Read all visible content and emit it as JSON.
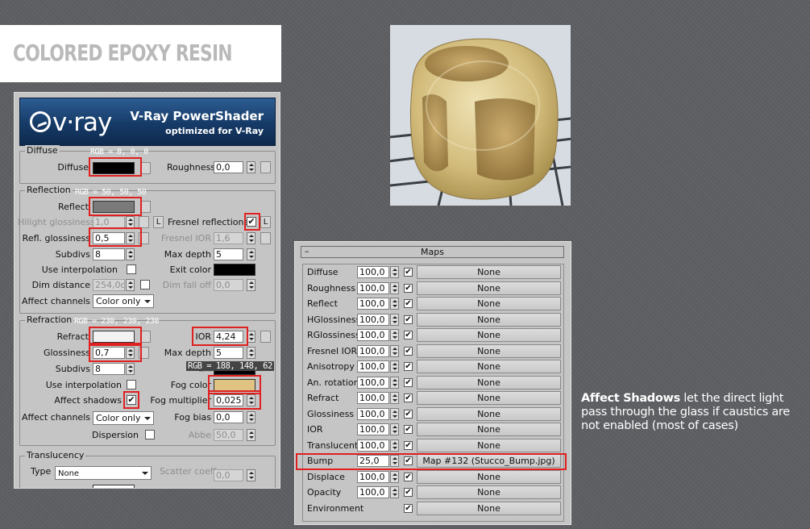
{
  "title": "COLORED EPOXY RESIN",
  "vray": {
    "logo": "v·ray",
    "header_title": "V-Ray PowerShader",
    "header_subtitle": "optimized for V-Ray"
  },
  "diffuse": {
    "group": "Diffuse",
    "rgb_note": "RGB = 0, 0, 0",
    "diffuse_label": "Diffuse",
    "diffuse_color": "#000000",
    "roughness_label": "Roughness",
    "roughness_value": "0,0"
  },
  "reflection": {
    "group": "Reflection",
    "rgb_note": "RGB = 50, 50, 50",
    "reflect_label": "Reflect",
    "reflect_color": "#323232",
    "hilight_label": "Hilight glossiness",
    "hilight_value": "1,0",
    "l_label": "L",
    "fresnel_label": "Fresnel reflections",
    "fresnel_checked": "✔",
    "refl_gloss_label": "Refl. glossiness",
    "refl_gloss_value": "0,5",
    "fresnel_ior_label": "Fresnel IOR",
    "fresnel_ior_value": "1,6",
    "subdivs_label": "Subdivs",
    "subdivs_value": "8",
    "max_depth_label": "Max depth",
    "max_depth_value": "5",
    "use_interp_label": "Use interpolation",
    "exit_color_label": "Exit color",
    "dim_distance_label": "Dim distance",
    "dim_distance_value": "254,0c",
    "dim_falloff_label": "Dim fall off",
    "dim_falloff_value": "0,0",
    "affect_channels_label": "Affect channels",
    "affect_channels_value": "Color only"
  },
  "refraction": {
    "group": "Refraction",
    "rgb_note": "RGB = 230, 230, 230",
    "refract_label": "Refract",
    "refract_color": "#e6e6e6",
    "ior_label": "IOR",
    "ior_value": "4,24",
    "glossiness_label": "Glossiness",
    "glossiness_value": "0,7",
    "max_depth_label": "Max depth",
    "max_depth_value": "5",
    "subdivs_label": "Subdivs",
    "subdivs_value": "8",
    "exit_label": "Exi",
    "fog_rgb_note": "RGB = 188, 148, 62",
    "use_interp_label": "Use interpolation",
    "fog_color_label": "Fog color",
    "fog_color": "#bc943e",
    "affect_shadows_label": "Affect shadows",
    "affect_shadows_checked": "✔",
    "fog_mult_label": "Fog multiplier",
    "fog_mult_value": "0,025",
    "affect_channels_label": "Affect channels",
    "affect_channels_value": "Color only",
    "fog_bias_label": "Fog bias",
    "fog_bias_value": "0,0",
    "dispersion_label": "Dispersion",
    "abbe_label": "Abbe",
    "abbe_value": "50,0"
  },
  "translucency": {
    "group": "Translucency",
    "type_label": "Type",
    "type_value": "None",
    "scatter_label": "Scatter coeff",
    "scatter_value": "0,0"
  },
  "maps": {
    "minus": "–",
    "title": "Maps",
    "check": "✔",
    "rows": [
      {
        "label": "Diffuse",
        "value": "100,0",
        "map": "None"
      },
      {
        "label": "Roughness",
        "value": "100,0",
        "map": "None"
      },
      {
        "label": "Reflect",
        "value": "100,0",
        "map": "None"
      },
      {
        "label": "HGlossiness",
        "value": "100,0",
        "map": "None"
      },
      {
        "label": "RGlossiness",
        "value": "100,0",
        "map": "None"
      },
      {
        "label": "Fresnel IOR",
        "value": "100,0",
        "map": "None"
      },
      {
        "label": "Anisotropy",
        "value": "100,0",
        "map": "None"
      },
      {
        "label": "An. rotation",
        "value": "100,0",
        "map": "None"
      },
      {
        "label": "Refract",
        "value": "100,0",
        "map": "None"
      },
      {
        "label": "Glossiness",
        "value": "100,0",
        "map": "None"
      },
      {
        "label": "IOR",
        "value": "100,0",
        "map": "None"
      },
      {
        "label": "Translucent",
        "value": "100,0",
        "map": "None"
      },
      {
        "label": "Bump",
        "value": "25,0",
        "map": "Map #132 (Stucco_Bump.jpg)"
      },
      {
        "label": "Displace",
        "value": "100,0",
        "map": "None"
      },
      {
        "label": "Opacity",
        "value": "100,0",
        "map": "None"
      },
      {
        "label": "Environment",
        "value": "",
        "map": "None"
      }
    ]
  },
  "note": {
    "bold": "Affect Shadows",
    "text": " let the direct light pass through the glass if caustics are not enabled (most of cases)"
  }
}
